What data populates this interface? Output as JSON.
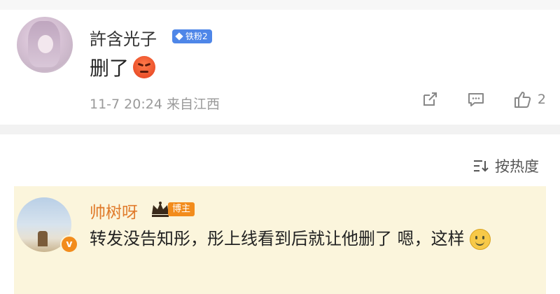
{
  "comment1": {
    "username": "許含光子",
    "fan_badge": "铁粉2",
    "text": "删了",
    "meta": "11-7 20:24 来自江西",
    "actions": {
      "like_count": "2"
    }
  },
  "sort": {
    "label": "按热度"
  },
  "comment2": {
    "username": "帅树呀",
    "author_tag": "博主",
    "text": "转发没告知彤，彤上线看到后就让他删了  嗯，这样",
    "accent_color": "#e07a2a"
  },
  "colors": {
    "fan_badge": "#4e86e8",
    "author_tag": "#f28c1c",
    "highlight_bg": "#fbf5dc"
  }
}
